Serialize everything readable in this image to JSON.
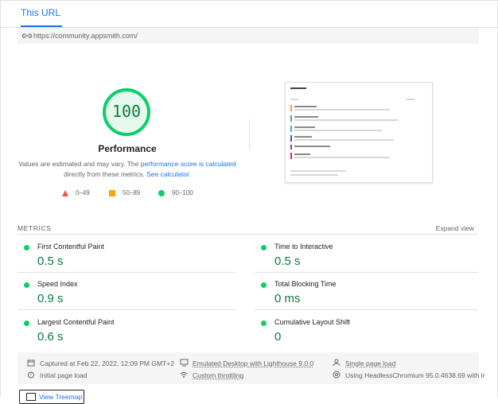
{
  "tab": {
    "label": "This URL"
  },
  "url": "https://community.appsmith.com/",
  "performance": {
    "score": "100",
    "score_value": 100,
    "title": "Performance",
    "desc_prefix": "Values are estimated and may vary. The ",
    "desc_link1": "performance score is calculated",
    "desc_middle": " directly from these metrics. ",
    "desc_link2": "See calculator."
  },
  "legend": [
    {
      "range": "0–49",
      "icon": "triangle-icon",
      "color": "#ff4e42"
    },
    {
      "range": "50–89",
      "icon": "square-icon",
      "color": "#ffa400"
    },
    {
      "range": "90–100",
      "icon": "circle-icon",
      "color": "#0cce6b"
    }
  ],
  "metrics": {
    "label": "METRICS",
    "expand": "Expand view",
    "items": [
      {
        "name": "First Contentful Paint",
        "value": "0.5 s"
      },
      {
        "name": "Time to Interactive",
        "value": "0.5 s"
      },
      {
        "name": "Speed Index",
        "value": "0.9 s"
      },
      {
        "name": "Total Blocking Time",
        "value": "0 ms"
      },
      {
        "name": "Largest Contentful Paint",
        "value": "0.6 s"
      },
      {
        "name": "Cumulative Layout Shift",
        "value": "0"
      }
    ]
  },
  "footer": {
    "captured": "Captured at Feb 22, 2022, 12:09 PM GMT+2",
    "emulated": "Emulated Desktop with Lighthouse 9.0.0",
    "single": "Single page load",
    "initial": "Initial page load",
    "throttling": "Custom throttling",
    "browser": "Using HeadlessChromium 95.0.4638.69 with lr"
  },
  "treemap": {
    "label": "View Treemap"
  },
  "colors": {
    "pass": "#0cce6b",
    "pass_text": "#0b7a3b",
    "link": "#1a73e8"
  }
}
